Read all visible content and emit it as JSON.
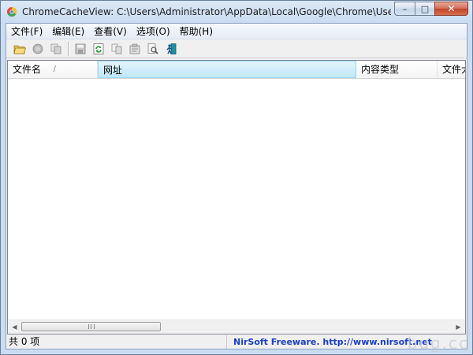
{
  "window": {
    "title": "ChromeCacheView:  C:\\Users\\Administrator\\AppData\\Local\\Google\\Chrome\\User D...",
    "minimize_glyph": "–",
    "maximize_glyph": "□",
    "close_glyph": "✕"
  },
  "menu": {
    "items": [
      {
        "label": "文件(F)"
      },
      {
        "label": "编辑(E)"
      },
      {
        "label": "查看(V)"
      },
      {
        "label": "选项(O)"
      },
      {
        "label": "帮助(H)"
      }
    ]
  },
  "toolbar": {
    "buttons": [
      {
        "icon": "open-folder-icon"
      },
      {
        "icon": "stop-icon"
      },
      {
        "icon": "copy-files-icon"
      },
      {
        "icon": "save-icon"
      },
      {
        "icon": "refresh-icon"
      },
      {
        "icon": "copy-icon"
      },
      {
        "icon": "properties-icon"
      },
      {
        "icon": "find-icon"
      },
      {
        "icon": "exit-icon"
      }
    ]
  },
  "list": {
    "columns": [
      {
        "label": "文件名",
        "sort_mark": "/"
      },
      {
        "label": "网址"
      },
      {
        "label": "内容类型"
      },
      {
        "label": "文件大小"
      }
    ],
    "rows": []
  },
  "scrollbar": {
    "left_glyph": "◀",
    "right_glyph": "▶"
  },
  "status": {
    "count": "共 0 项",
    "credit": "NirSoft Freeware.  http://www.nirsoft.net"
  },
  "watermark": "bug.cc",
  "colors": {
    "accent": "#1a3fc4",
    "selected_header": "#bfe7f8"
  }
}
